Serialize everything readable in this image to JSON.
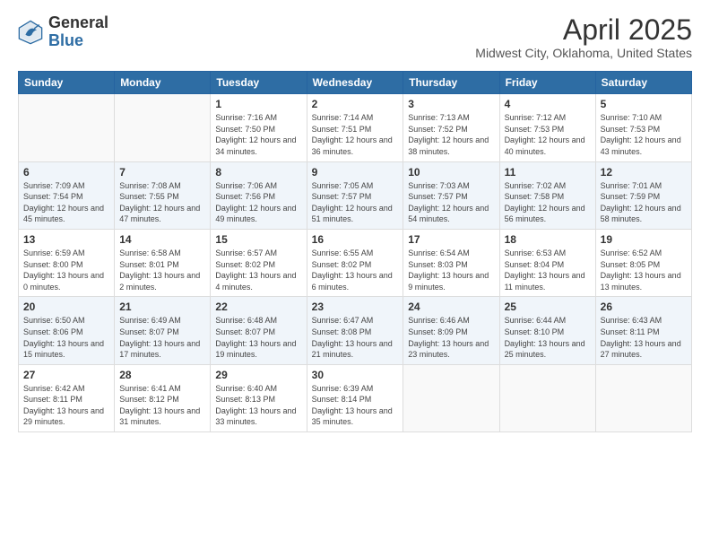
{
  "header": {
    "logo_general": "General",
    "logo_blue": "Blue",
    "month": "April 2025",
    "location": "Midwest City, Oklahoma, United States"
  },
  "weekdays": [
    "Sunday",
    "Monday",
    "Tuesday",
    "Wednesday",
    "Thursday",
    "Friday",
    "Saturday"
  ],
  "weeks": [
    [
      {
        "day": "",
        "info": ""
      },
      {
        "day": "",
        "info": ""
      },
      {
        "day": "1",
        "info": "Sunrise: 7:16 AM\nSunset: 7:50 PM\nDaylight: 12 hours and 34 minutes."
      },
      {
        "day": "2",
        "info": "Sunrise: 7:14 AM\nSunset: 7:51 PM\nDaylight: 12 hours and 36 minutes."
      },
      {
        "day": "3",
        "info": "Sunrise: 7:13 AM\nSunset: 7:52 PM\nDaylight: 12 hours and 38 minutes."
      },
      {
        "day": "4",
        "info": "Sunrise: 7:12 AM\nSunset: 7:53 PM\nDaylight: 12 hours and 40 minutes."
      },
      {
        "day": "5",
        "info": "Sunrise: 7:10 AM\nSunset: 7:53 PM\nDaylight: 12 hours and 43 minutes."
      }
    ],
    [
      {
        "day": "6",
        "info": "Sunrise: 7:09 AM\nSunset: 7:54 PM\nDaylight: 12 hours and 45 minutes."
      },
      {
        "day": "7",
        "info": "Sunrise: 7:08 AM\nSunset: 7:55 PM\nDaylight: 12 hours and 47 minutes."
      },
      {
        "day": "8",
        "info": "Sunrise: 7:06 AM\nSunset: 7:56 PM\nDaylight: 12 hours and 49 minutes."
      },
      {
        "day": "9",
        "info": "Sunrise: 7:05 AM\nSunset: 7:57 PM\nDaylight: 12 hours and 51 minutes."
      },
      {
        "day": "10",
        "info": "Sunrise: 7:03 AM\nSunset: 7:57 PM\nDaylight: 12 hours and 54 minutes."
      },
      {
        "day": "11",
        "info": "Sunrise: 7:02 AM\nSunset: 7:58 PM\nDaylight: 12 hours and 56 minutes."
      },
      {
        "day": "12",
        "info": "Sunrise: 7:01 AM\nSunset: 7:59 PM\nDaylight: 12 hours and 58 minutes."
      }
    ],
    [
      {
        "day": "13",
        "info": "Sunrise: 6:59 AM\nSunset: 8:00 PM\nDaylight: 13 hours and 0 minutes."
      },
      {
        "day": "14",
        "info": "Sunrise: 6:58 AM\nSunset: 8:01 PM\nDaylight: 13 hours and 2 minutes."
      },
      {
        "day": "15",
        "info": "Sunrise: 6:57 AM\nSunset: 8:02 PM\nDaylight: 13 hours and 4 minutes."
      },
      {
        "day": "16",
        "info": "Sunrise: 6:55 AM\nSunset: 8:02 PM\nDaylight: 13 hours and 6 minutes."
      },
      {
        "day": "17",
        "info": "Sunrise: 6:54 AM\nSunset: 8:03 PM\nDaylight: 13 hours and 9 minutes."
      },
      {
        "day": "18",
        "info": "Sunrise: 6:53 AM\nSunset: 8:04 PM\nDaylight: 13 hours and 11 minutes."
      },
      {
        "day": "19",
        "info": "Sunrise: 6:52 AM\nSunset: 8:05 PM\nDaylight: 13 hours and 13 minutes."
      }
    ],
    [
      {
        "day": "20",
        "info": "Sunrise: 6:50 AM\nSunset: 8:06 PM\nDaylight: 13 hours and 15 minutes."
      },
      {
        "day": "21",
        "info": "Sunrise: 6:49 AM\nSunset: 8:07 PM\nDaylight: 13 hours and 17 minutes."
      },
      {
        "day": "22",
        "info": "Sunrise: 6:48 AM\nSunset: 8:07 PM\nDaylight: 13 hours and 19 minutes."
      },
      {
        "day": "23",
        "info": "Sunrise: 6:47 AM\nSunset: 8:08 PM\nDaylight: 13 hours and 21 minutes."
      },
      {
        "day": "24",
        "info": "Sunrise: 6:46 AM\nSunset: 8:09 PM\nDaylight: 13 hours and 23 minutes."
      },
      {
        "day": "25",
        "info": "Sunrise: 6:44 AM\nSunset: 8:10 PM\nDaylight: 13 hours and 25 minutes."
      },
      {
        "day": "26",
        "info": "Sunrise: 6:43 AM\nSunset: 8:11 PM\nDaylight: 13 hours and 27 minutes."
      }
    ],
    [
      {
        "day": "27",
        "info": "Sunrise: 6:42 AM\nSunset: 8:11 PM\nDaylight: 13 hours and 29 minutes."
      },
      {
        "day": "28",
        "info": "Sunrise: 6:41 AM\nSunset: 8:12 PM\nDaylight: 13 hours and 31 minutes."
      },
      {
        "day": "29",
        "info": "Sunrise: 6:40 AM\nSunset: 8:13 PM\nDaylight: 13 hours and 33 minutes."
      },
      {
        "day": "30",
        "info": "Sunrise: 6:39 AM\nSunset: 8:14 PM\nDaylight: 13 hours and 35 minutes."
      },
      {
        "day": "",
        "info": ""
      },
      {
        "day": "",
        "info": ""
      },
      {
        "day": "",
        "info": ""
      }
    ]
  ]
}
